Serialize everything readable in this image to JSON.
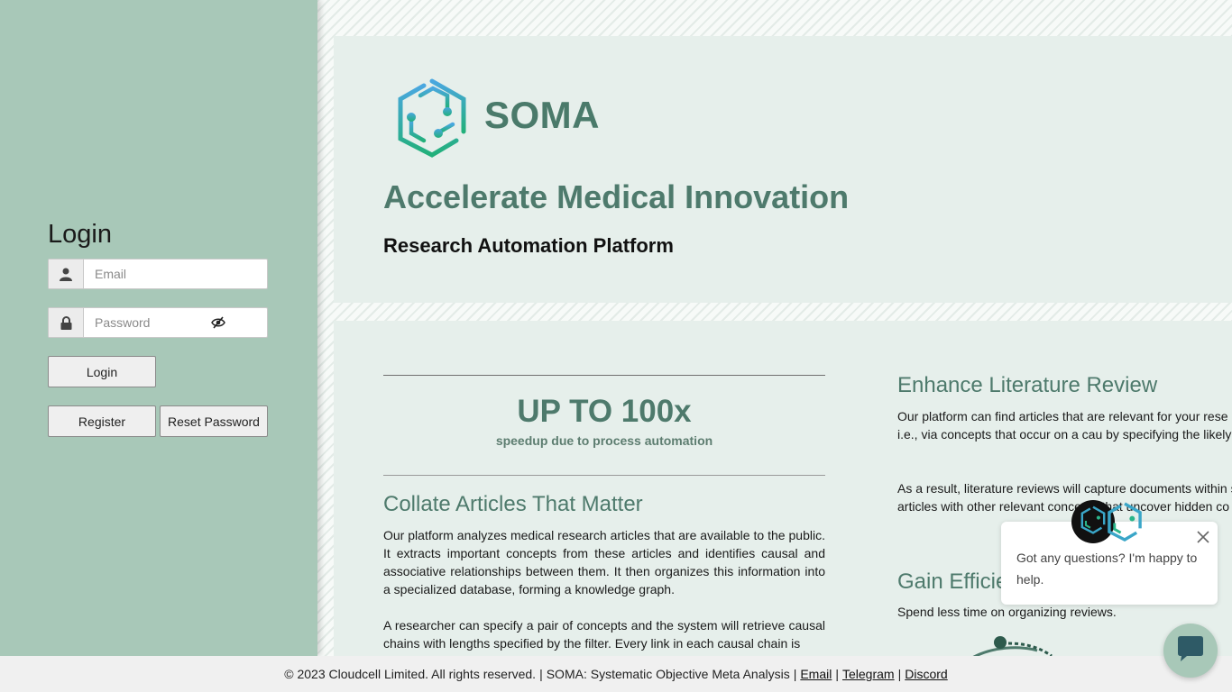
{
  "login": {
    "title": "Login",
    "email_placeholder": "Email",
    "password_placeholder": "Password",
    "login_label": "Login",
    "register_label": "Register",
    "reset_label": "Reset Password"
  },
  "hero": {
    "brand": "SOMA",
    "headline": "Accelerate Medical Innovation",
    "subheadline": "Research Automation Platform"
  },
  "stat": {
    "big": "UP TO 100x",
    "small": "speedup due to process automation"
  },
  "sections": {
    "collate": {
      "title": "Collate Articles That Matter",
      "p1": "Our platform analyzes medical research articles that are available to the public. It extracts important concepts from these articles and identifies causal and associative relationships between them. It then organizes this information into a specialized database, forming a knowledge graph.",
      "p2": "A researcher can specify a pair of concepts and the system will retrieve causal chains with lengths specified by the filter. Every link in each causal chain is"
    },
    "enhance": {
      "title": "Enhance Literature Review",
      "p1": "Our platform can find articles that are relevant for your rese mechanism of action, i.e., via concepts that occur on a cau by specifying the likely cause and effect.",
      "p2": "As a result, literature reviews will capture documents within specify, as well as articles with other relevant concepts that uncover hidden co                                                  le gle entirety."
    },
    "gain": {
      "title": "Gain Efficie",
      "p": "Spend less time on organizing reviews."
    }
  },
  "chat": {
    "message": "Got any questions? I'm happy to help."
  },
  "footer": {
    "copyright": "© 2023 Cloudcell Limited. All rights reserved.",
    "product": "SOMA: Systematic Objective Meta Analysis",
    "email": "Email",
    "telegram": "Telegram",
    "discord": "Discord"
  },
  "colors": {
    "sidebar": "#a8c8b8",
    "accent": "#4e7a6c",
    "card": "#e6efeb"
  },
  "icons": [
    "user-icon",
    "lock-icon",
    "eye-slash-icon",
    "soma-logo-icon",
    "close-icon",
    "chat-icon"
  ]
}
